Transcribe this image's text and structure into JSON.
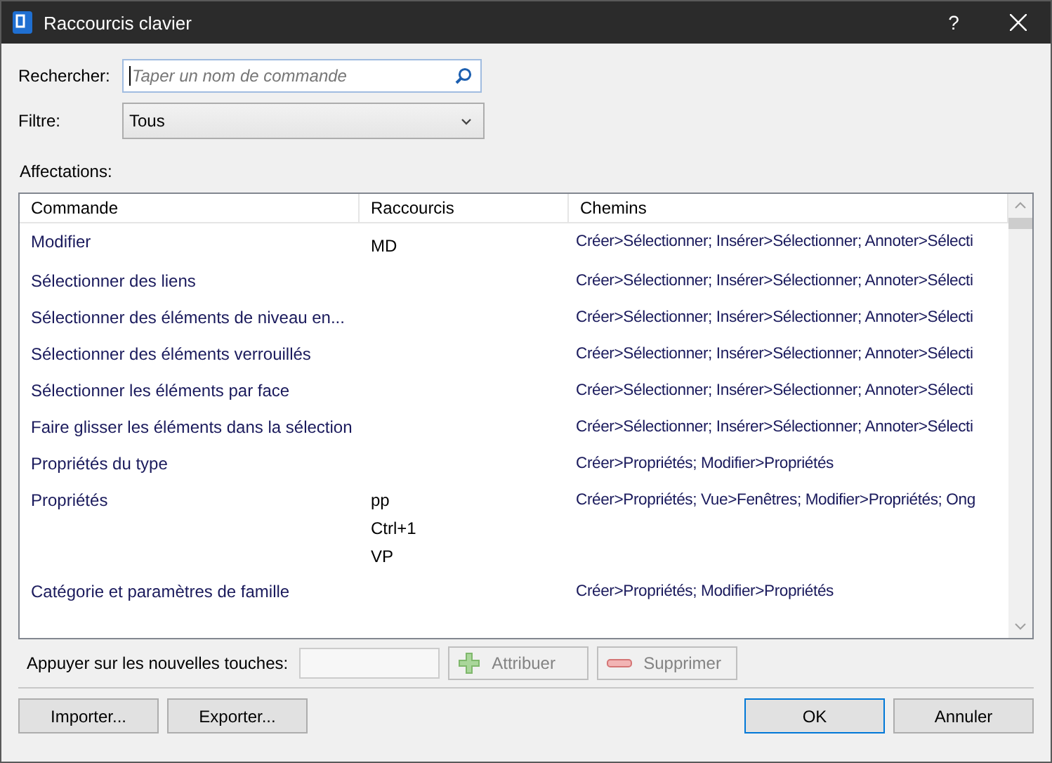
{
  "window": {
    "title": "Raccourcis clavier",
    "help": "?"
  },
  "search": {
    "label": "Rechercher:",
    "placeholder": "Taper un nom de commande"
  },
  "filter": {
    "label": "Filtre:",
    "value": "Tous"
  },
  "assignments_label": "Affectations:",
  "table": {
    "columns": [
      "Commande",
      "Raccourcis",
      "Chemins"
    ],
    "rows": [
      {
        "command": "Modifier",
        "shortcuts": [
          "MD"
        ],
        "paths": "Créer>Sélectionner; Insérer>Sélectionner; Annoter>Sélecti"
      },
      {
        "command": "Sélectionner des liens",
        "shortcuts": [],
        "paths": "Créer>Sélectionner; Insérer>Sélectionner; Annoter>Sélecti"
      },
      {
        "command": "Sélectionner des éléments de niveau en...",
        "shortcuts": [],
        "paths": "Créer>Sélectionner; Insérer>Sélectionner; Annoter>Sélecti"
      },
      {
        "command": "Sélectionner des éléments verrouillés",
        "shortcuts": [],
        "paths": "Créer>Sélectionner; Insérer>Sélectionner; Annoter>Sélecti"
      },
      {
        "command": "Sélectionner les éléments par face",
        "shortcuts": [],
        "paths": "Créer>Sélectionner; Insérer>Sélectionner; Annoter>Sélecti"
      },
      {
        "command": "Faire glisser les éléments dans la sélection",
        "shortcuts": [],
        "paths": "Créer>Sélectionner; Insérer>Sélectionner; Annoter>Sélecti"
      },
      {
        "command": "Propriétés du type",
        "shortcuts": [],
        "paths": "Créer>Propriétés; Modifier>Propriétés"
      },
      {
        "command": "Propriétés",
        "shortcuts": [
          "pp",
          "Ctrl+1",
          "VP"
        ],
        "paths": "Créer>Propriétés; Vue>Fenêtres; Modifier>Propriétés; Ong"
      },
      {
        "command": "Catégorie et paramètres de famille",
        "shortcuts": [],
        "paths": "Créer>Propriétés; Modifier>Propriétés"
      }
    ]
  },
  "new_keys": {
    "label": "Appuyer sur les nouvelles touches:"
  },
  "edit_buttons": [
    {
      "kind": "add",
      "label": "Attribuer",
      "disabled": true
    },
    {
      "kind": "remove",
      "label": "Supprimer",
      "disabled": true
    }
  ],
  "footer_left": [
    {
      "label": "Importer...",
      "default": false
    },
    {
      "label": "Exporter...",
      "default": false
    }
  ],
  "footer_right": [
    {
      "label": "OK",
      "default": true
    },
    {
      "label": "Annuler",
      "default": false
    }
  ]
}
